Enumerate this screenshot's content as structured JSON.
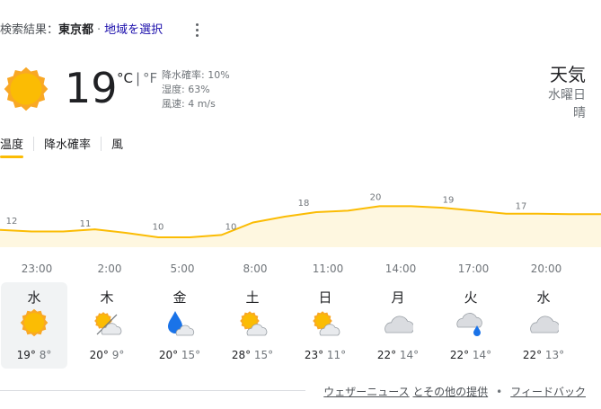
{
  "location": {
    "label": "検索結果：",
    "city": "東京都",
    "separator": "·",
    "change_link": "地域を選択"
  },
  "current": {
    "icon": "sun-icon",
    "temperature": "19",
    "unit_c": "°C",
    "unit_sep": "|",
    "unit_f": "°F",
    "precip": "降水確率: 10%",
    "humidity": "湿度: 63%",
    "wind": "風速: 4 m/s"
  },
  "header_right": {
    "title": "天気",
    "day": "水曜日",
    "condition": "晴"
  },
  "tabs": [
    {
      "label": "温度",
      "active": true
    },
    {
      "label": "降水確率",
      "active": false
    },
    {
      "label": "風",
      "active": false
    }
  ],
  "colors": {
    "accent": "#fbbc04",
    "chart_fill": "#fef7e0",
    "sun": "#f9a825",
    "rain": "#1a73e8",
    "cloud": "#bdc1c6"
  },
  "chart_data": {
    "type": "area",
    "x": [
      "23:00",
      "2:00",
      "5:00",
      "8:00",
      "11:00",
      "14:00",
      "17:00",
      "20:00"
    ],
    "values": [
      12,
      11,
      10,
      10,
      18,
      20,
      19,
      17
    ],
    "labels": [
      "12",
      "11",
      "10",
      "10",
      "18",
      "20",
      "19",
      "17"
    ],
    "series_line": [
      12,
      11.5,
      11.5,
      12.2,
      11,
      9.5,
      9.5,
      10.3,
      14.5,
      16.5,
      18,
      18.5,
      20,
      20,
      19.5,
      18.5,
      17.5,
      17.5,
      17.3,
      17.3
    ],
    "grid": false
  },
  "hours": [
    "23:00",
    "2:00",
    "5:00",
    "8:00",
    "11:00",
    "14:00",
    "17:00",
    "20:00"
  ],
  "days": [
    {
      "name": "水",
      "icon": "sun-icon",
      "high": "19°",
      "low": "8°",
      "selected": true
    },
    {
      "name": "木",
      "icon": "partly-cloudy-icon",
      "high": "20°",
      "low": "9°",
      "selected": false
    },
    {
      "name": "金",
      "icon": "rain-cloud-icon",
      "high": "20°",
      "low": "15°",
      "selected": false
    },
    {
      "name": "土",
      "icon": "sun-cloud-icon",
      "high": "28°",
      "low": "15°",
      "selected": false
    },
    {
      "name": "日",
      "icon": "sun-cloud-icon",
      "high": "23°",
      "low": "11°",
      "selected": false
    },
    {
      "name": "月",
      "icon": "cloud-icon",
      "high": "22°",
      "low": "14°",
      "selected": false
    },
    {
      "name": "火",
      "icon": "cloud-rain-icon",
      "high": "22°",
      "low": "14°",
      "selected": false
    },
    {
      "name": "水",
      "icon": "cloud-icon",
      "high": "22°",
      "low": "13°",
      "selected": false
    }
  ],
  "footer": {
    "source": "ウェザーニュース",
    "others": "とその他の提供",
    "bullet": "•",
    "feedback": "フィードバック"
  }
}
